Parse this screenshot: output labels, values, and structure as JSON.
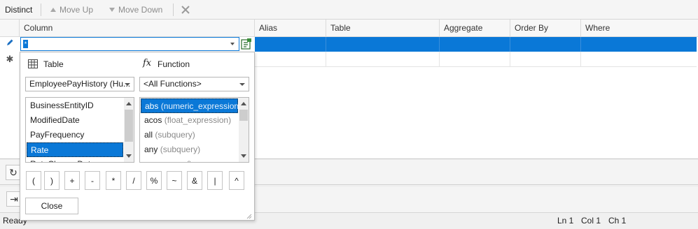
{
  "toolbar": {
    "distinct_label": "Distinct",
    "move_up_label": "Move Up",
    "move_down_label": "Move Down",
    "delete_icon": "close-x-icon"
  },
  "grid": {
    "columns": [
      "Column",
      "Alias",
      "Table",
      "Aggregate",
      "Order By",
      "Where"
    ],
    "current_value": "*",
    "row_indicators": {
      "editing_icon": "pencil-icon",
      "new_row_icon": "asterisk-icon"
    },
    "selection_color": "#0a78d7"
  },
  "editor": {
    "table_section_label": "Table",
    "function_section_label": "Function",
    "fx_glyph": "fx",
    "table_select_value": "EmployeePayHistory (Hu...",
    "function_select_value": "<All Functions>",
    "fields": [
      "BusinessEntityID",
      "ModifiedDate",
      "PayFrequency",
      "Rate",
      "RateChangeDate"
    ],
    "selected_field": "Rate",
    "functions": [
      {
        "name": "abs",
        "args": "(numeric_expression)"
      },
      {
        "name": "acos",
        "args": "(float_expression)"
      },
      {
        "name": "all",
        "args": "(subquery)"
      },
      {
        "name": "any",
        "args": "(subquery)"
      },
      {
        "name": "app_name",
        "args": "()"
      }
    ],
    "operators": [
      "(",
      ")",
      "+",
      "-",
      "*",
      "/",
      "%",
      "~",
      "&",
      "|",
      "^"
    ],
    "close_label": "Close"
  },
  "status": {
    "ready": "Ready",
    "line": "Ln 1",
    "col": "Col 1",
    "ch": "Ch 1"
  }
}
